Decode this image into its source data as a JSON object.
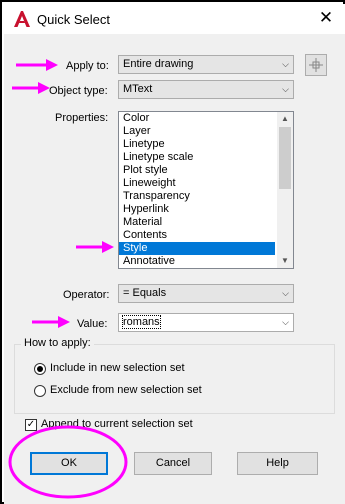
{
  "window": {
    "title": "Quick Select",
    "close_glyph": "✕"
  },
  "apply_to": {
    "label": "Apply to:",
    "value": "Entire drawing"
  },
  "object_type": {
    "label": "Object type:",
    "value": "MText"
  },
  "properties": {
    "label": "Properties:",
    "items": [
      "Color",
      "Layer",
      "Linetype",
      "Linetype scale",
      "Plot style",
      "Lineweight",
      "Transparency",
      "Hyperlink",
      "Material",
      "Contents",
      "Style",
      "Annotative"
    ],
    "selected": "Style"
  },
  "operator": {
    "label": "Operator:",
    "value": "= Equals"
  },
  "value": {
    "label": "Value:",
    "value": "romans"
  },
  "how_to_apply": {
    "legend": "How to apply:",
    "include_label": "Include in new selection set",
    "exclude_label": "Exclude from new selection set",
    "selected": "include"
  },
  "append": {
    "label": "Append to current selection set",
    "checked": true,
    "check_glyph": "✓"
  },
  "buttons": {
    "ok": "OK",
    "cancel": "Cancel",
    "help": "Help"
  },
  "icons": {
    "app": "autocad-icon",
    "pick": "select-objects-icon",
    "chevron": "chevron-down-icon"
  },
  "colors": {
    "annotation": "#ff00ff",
    "selection": "#0078d7",
    "app_icon": "#c8102e"
  }
}
